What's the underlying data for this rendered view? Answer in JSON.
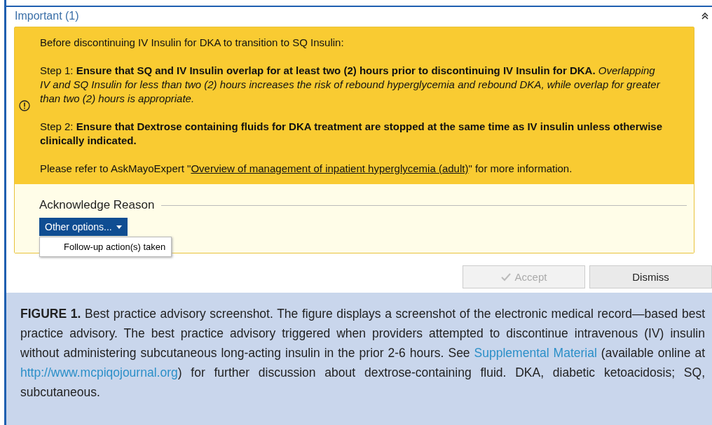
{
  "section": {
    "title": "Important (1)",
    "expanded": true
  },
  "advisory": {
    "intro": "Before discontinuing IV Insulin for DKA to transition to SQ Insulin:",
    "steps": [
      "Step 1: **Ensure that SQ and IV Insulin overlap for at least two (2) hours prior to discontinuing IV Insulin for DKA.** *Overlapping IV and SQ Insulin for less than two (2) hours increases the risk of rebound hyperglycemia and rebound DKA, while overlap for greater than two (2) hours is appropriate.*",
      "Step 2: **Ensure that Dextrose containing fluids for DKA treatment are stopped at the same time as IV insulin unless otherwise clinically indicated.**"
    ],
    "reference": [
      {
        "kind": "text",
        "text": "Please refer to AskMayoExpert \""
      },
      {
        "kind": "link",
        "text": "Overview of management of inpatient hyperglycemia (adult)"
      },
      {
        "kind": "text",
        "text": "\" for more information."
      }
    ]
  },
  "acknowledge": {
    "label": "Acknowledge Reason",
    "dropdown": {
      "label": "Other options...",
      "expanded": true,
      "options": [
        "Follow-up action(s) taken"
      ]
    }
  },
  "buttons": [
    {
      "label": "Accept",
      "disabled": true,
      "kind": "accept"
    },
    {
      "label": "Dismiss",
      "disabled": false,
      "kind": "plain"
    }
  ],
  "caption": [
    {
      "kind": "text",
      "text": "**FIGURE 1.** Best practice advisory screenshot. The figure displays a screenshot of the electronic medical record—based best practice advisory. The best practice advisory triggered when providers attempted to discontinue intravenous (IV) insulin without administering subcutaneous long-acting insulin in the prior 2-6 hours. See "
    },
    {
      "kind": "link",
      "text": "Supplemental Material"
    },
    {
      "kind": "text",
      "text": " (available online at "
    },
    {
      "kind": "link",
      "text": "http://www.mcpiqojournal.org"
    },
    {
      "kind": "text",
      "text": ") for further discussion about dextrose-containing fluid. DKA, diabetic ketoacidosis; SQ, subcutaneous."
    }
  ]
}
